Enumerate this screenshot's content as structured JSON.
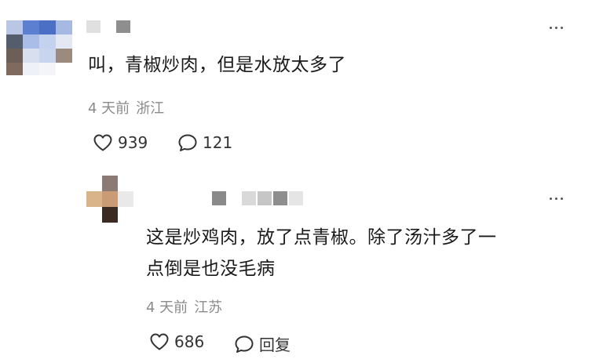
{
  "comments": [
    {
      "text": "叫，青椒炒肉，但是水放太多了",
      "time": "4 天前",
      "location": "浙江",
      "likes": "939",
      "replies": "121"
    },
    {
      "text_line1": "这是炒鸡肉，放了点青椒。除了汤汁多了一",
      "text_line2": "点倒是也没毛病",
      "time": "4 天前",
      "location": "江苏",
      "likes": "686",
      "reply_label": "回复"
    }
  ],
  "icons": {
    "more": "more-dots-icon",
    "like": "heart-icon",
    "comment": "comment-bubble-icon"
  },
  "colors": {
    "text": "#1a1a1a",
    "meta": "#8a8a8a",
    "icon": "#333333"
  }
}
